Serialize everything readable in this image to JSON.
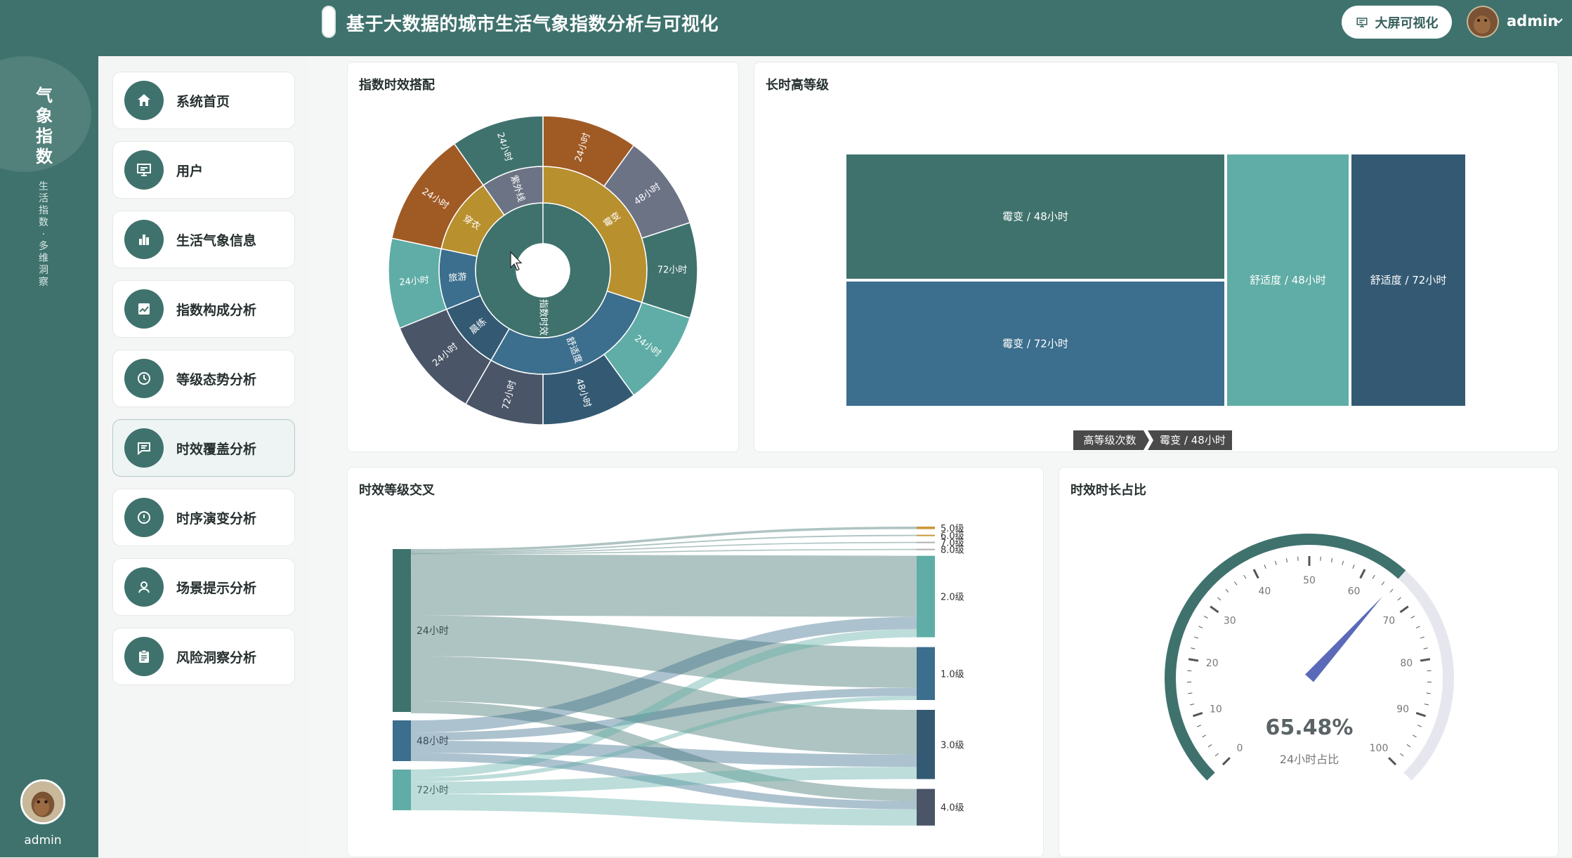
{
  "header": {
    "title": "基于大数据的城市生活气象指数分析与可视化",
    "screen_button": "大屏可视化",
    "user": "admin"
  },
  "rail": {
    "title_chars": [
      "气",
      "象",
      "指",
      "数"
    ],
    "subtitle_chars": [
      "生",
      "活",
      "指",
      "数",
      "·",
      "多",
      "维",
      "洞",
      "察"
    ],
    "user": "admin"
  },
  "sidebar": {
    "items": [
      {
        "label": "系统首页",
        "icon": "home-icon"
      },
      {
        "label": "用户",
        "icon": "presentation-icon"
      },
      {
        "label": "生活气象信息",
        "icon": "bar-chart-icon"
      },
      {
        "label": "指数构成分析",
        "icon": "trend-icon"
      },
      {
        "label": "等级态势分析",
        "icon": "clock-icon"
      },
      {
        "label": "时效覆盖分析",
        "icon": "message-icon",
        "active": true
      },
      {
        "label": "时序演变分析",
        "icon": "info-icon"
      },
      {
        "label": "场景提示分析",
        "icon": "user-icon"
      },
      {
        "label": "风险洞察分析",
        "icon": "clipboard-icon"
      }
    ]
  },
  "colors": {
    "primary": "#3f726d",
    "teal_light": "#5fada6",
    "blue": "#3c6e8d",
    "navy": "#345a73",
    "brown": "#a05a24",
    "gold": "#b8902e",
    "slate": "#4a5568",
    "gray_blue": "#6b7385"
  },
  "panels": {
    "sunburst_title": "指数时效搭配",
    "treemap_title": "长时高等级",
    "sankey_title": "时效等级交叉",
    "gauge_title": "时效时长占比"
  },
  "chart_data": [
    {
      "type": "sunburst",
      "title": "指数时效搭配",
      "center": "指数时效",
      "inner": [
        "霉变",
        "舒适度",
        "晨练",
        "旅游",
        "穿衣",
        "紫外线"
      ],
      "outer": [
        {
          "parent": "霉变",
          "label": "24小时"
        },
        {
          "parent": "霉变",
          "label": "48小时"
        },
        {
          "parent": "霉变",
          "label": "72小时"
        },
        {
          "parent": "舒适度",
          "label": "24小时"
        },
        {
          "parent": "舒适度",
          "label": "48小时"
        },
        {
          "parent": "舒适度",
          "label": "72小时"
        },
        {
          "parent": "晨练",
          "label": "24小时"
        },
        {
          "parent": "旅游",
          "label": "24小时"
        },
        {
          "parent": "穿衣",
          "label": "24小时"
        },
        {
          "parent": "紫外线",
          "label": "24小时"
        }
      ]
    },
    {
      "type": "treemap",
      "title": "长时高等级",
      "items": [
        {
          "name": "霉变 / 48小时",
          "value": 5
        },
        {
          "name": "霉变 / 72小时",
          "value": 5
        },
        {
          "name": "舒适度 / 48小时",
          "value": 3
        },
        {
          "name": "舒适度 / 72小时",
          "value": 3
        }
      ],
      "breadcrumb": [
        "高等级次数",
        "霉变 / 48小时"
      ]
    },
    {
      "type": "sankey",
      "title": "时效等级交叉",
      "sources": [
        {
          "name": "24小时",
          "value": 40
        },
        {
          "name": "48小时",
          "value": 10
        },
        {
          "name": "72小时",
          "value": 10
        }
      ],
      "targets": [
        {
          "name": "5.0级",
          "value": 0.6
        },
        {
          "name": "6.0级",
          "value": 0.3
        },
        {
          "name": "7.0级",
          "value": 0.2
        },
        {
          "name": "8.0级",
          "value": 0.2
        },
        {
          "name": "2.0级",
          "value": 20
        },
        {
          "name": "1.0级",
          "value": 13
        },
        {
          "name": "3.0级",
          "value": 17
        },
        {
          "name": "4.0级",
          "value": 9
        }
      ],
      "links": [
        {
          "source": "24小时",
          "target": "5.0级",
          "value": 0.6
        },
        {
          "source": "24小时",
          "target": "6.0级",
          "value": 0.3
        },
        {
          "source": "24小时",
          "target": "7.0级",
          "value": 0.2
        },
        {
          "source": "24小时",
          "target": "8.0级",
          "value": 0.2
        },
        {
          "source": "24小时",
          "target": "2.0级",
          "value": 15
        },
        {
          "source": "24小时",
          "target": "1.0级",
          "value": 10
        },
        {
          "source": "24小时",
          "target": "3.0级",
          "value": 11
        },
        {
          "source": "24小时",
          "target": "4.0级",
          "value": 3
        },
        {
          "source": "48小时",
          "target": "2.0级",
          "value": 3
        },
        {
          "source": "48小时",
          "target": "1.0级",
          "value": 2
        },
        {
          "source": "48小时",
          "target": "3.0级",
          "value": 3
        },
        {
          "source": "48小时",
          "target": "4.0级",
          "value": 2
        },
        {
          "source": "72小时",
          "target": "2.0级",
          "value": 2
        },
        {
          "source": "72小时",
          "target": "1.0级",
          "value": 1
        },
        {
          "source": "72小时",
          "target": "3.0级",
          "value": 3
        },
        {
          "source": "72小时",
          "target": "4.0级",
          "value": 4
        }
      ]
    },
    {
      "type": "gauge",
      "title": "时效时长占比",
      "value": 65.48,
      "min": 0,
      "max": 100,
      "ticks": [
        0,
        10,
        20,
        30,
        40,
        50,
        60,
        70,
        80,
        90,
        100
      ],
      "value_text": "65.48%",
      "label": "24小时占比"
    }
  ]
}
